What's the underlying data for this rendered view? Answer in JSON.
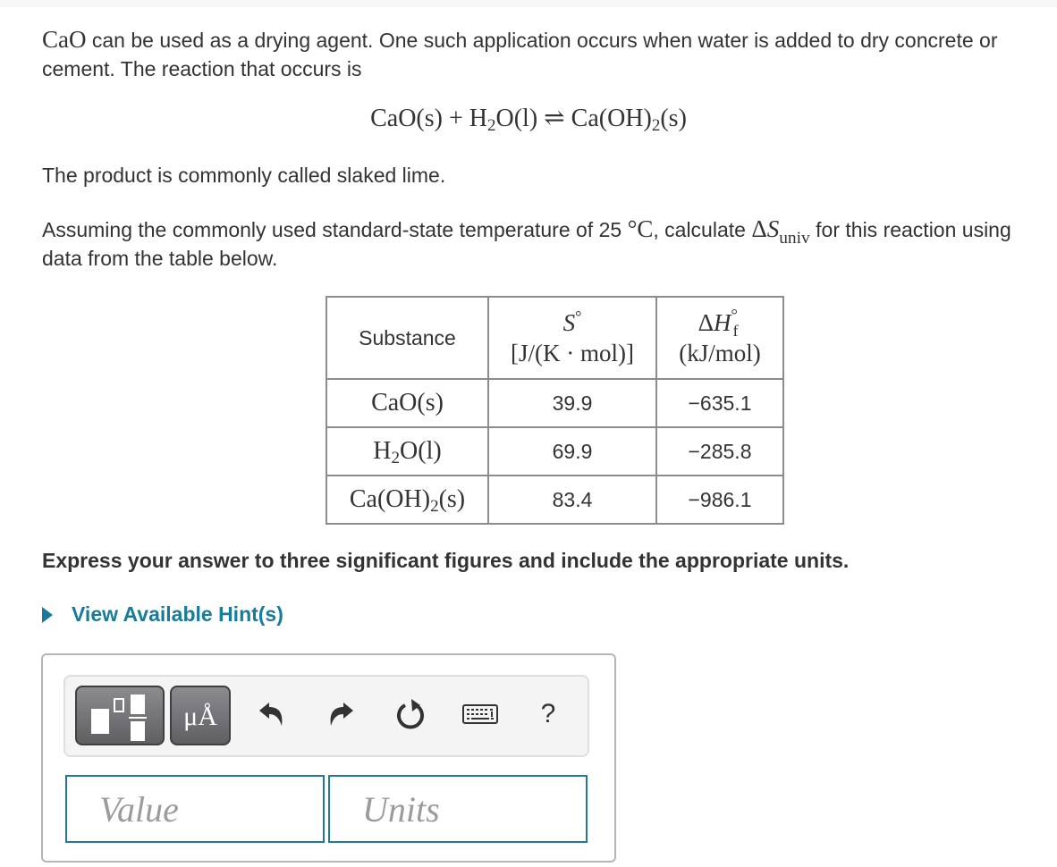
{
  "question": {
    "intro_formula": "CaO",
    "intro_text": " can be used as a drying agent. One such application occurs when water is added to dry concrete or cement. The reaction that occurs is",
    "equation": {
      "reactant1": "CaO(s)",
      "plus": "+",
      "reactant2_prefix": "H",
      "reactant2_sub": "2",
      "reactant2_suffix": "O(l)",
      "arrow": "⇌",
      "product_prefix": "Ca(OH)",
      "product_sub": "2",
      "product_suffix": "(s)"
    },
    "product_note": "The product is commonly called slaked lime.",
    "task_part1": "Assuming the commonly used standard-state temperature of 25 ",
    "task_temp_unit": "°C",
    "task_part2": ", calculate ",
    "task_symbol_delta": "Δ",
    "task_symbol_S": "S",
    "task_symbol_sub": "univ",
    "task_part3": " for this reaction using data from the table below."
  },
  "table": {
    "headers": {
      "substance": "Substance",
      "entropy_symbol": "S",
      "entropy_sup": "°",
      "entropy_units": "[J/(K · mol)]",
      "enthalpy_delta": "Δ",
      "enthalpy_symbol": "H",
      "enthalpy_sub": "f",
      "enthalpy_sup": "°",
      "enthalpy_units": "(kJ/mol)"
    },
    "rows": [
      {
        "prefix": "CaO(s)",
        "sub": "",
        "suffix": "",
        "entropy": "39.9",
        "enthalpy": "−635.1"
      },
      {
        "prefix": "H",
        "sub": "2",
        "suffix": "O(l)",
        "entropy": "69.9",
        "enthalpy": "−285.8"
      },
      {
        "prefix": "Ca(OH)",
        "sub": "2",
        "suffix": "(s)",
        "entropy": "83.4",
        "enthalpy": "−986.1"
      }
    ]
  },
  "instructions": "Express your answer to three significant figures and include the appropriate units.",
  "hint_link": "View Available Hint(s)",
  "toolbar": {
    "template_button": "templates-icon",
    "units_button_label": "μÅ",
    "undo": "undo-icon",
    "redo": "redo-icon",
    "reset": "reset-icon",
    "keyboard": "keyboard-icon",
    "help_label": "?"
  },
  "inputs": {
    "value_placeholder": "Value",
    "value": "",
    "units_placeholder": "Units",
    "units": ""
  },
  "colors": {
    "link": "#1a7a9a",
    "input_border": "#1f7a99",
    "text": "#333333"
  }
}
